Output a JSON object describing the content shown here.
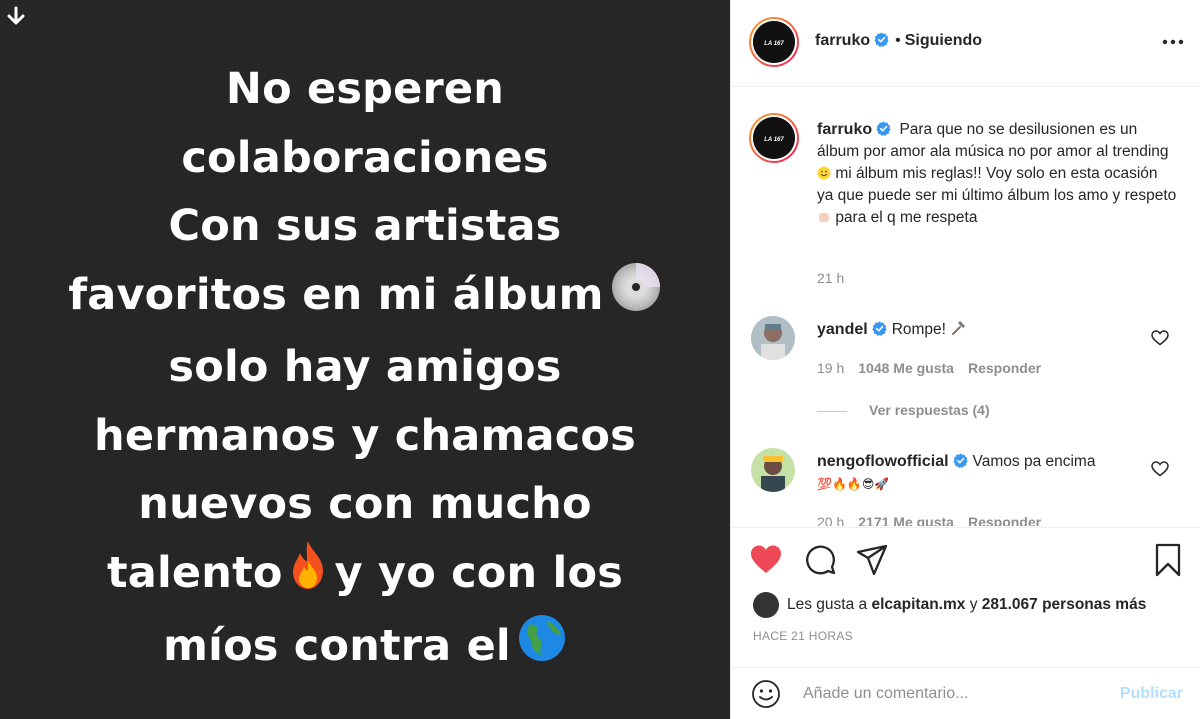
{
  "story": {
    "lines": [
      "No esperen",
      "colaboraciones",
      "Con sus artistas",
      "favoritos en mi álbum",
      "solo hay amigos",
      "hermanos y chamacos",
      "nuevos con mucho",
      "talento",
      "y yo con los",
      "míos contra el"
    ],
    "icons": [
      "cd-icon",
      "fire-icon",
      "globe-icon"
    ]
  },
  "header": {
    "username": "farruko",
    "separator": "•",
    "following_label": "Siguiendo"
  },
  "caption": {
    "username": "farruko",
    "text_part1": "Para que no se desilusionen es un álbum por amor ala música no por amor al trending",
    "text_part2": "mi álbum mis reglas!! Voy solo en esta ocasión ya que puede ser mi último álbum los amo y respeto",
    "text_part3": "para el q me respeta",
    "time": "21 h"
  },
  "comments": [
    {
      "username": "yandel",
      "text": "Rompe!",
      "time": "19 h",
      "likes": "1048 Me gusta",
      "reply_label": "Responder"
    },
    {
      "username": "nengoflowofficial",
      "text": "Vamos pa encima",
      "text_line2": "💯🔥🔥😎🚀",
      "time": "20 h",
      "likes": "2171 Me gusta",
      "reply_label": "Responder"
    }
  ],
  "view_replies": "Ver respuestas (4)",
  "likes_summary": {
    "prefix": "Les gusta a",
    "user": "elcapitan.mx",
    "connector": "y",
    "others": "281.067 personas más"
  },
  "posted_time": "HACE 21 HORAS",
  "add_comment": {
    "placeholder": "Añade un comentario...",
    "publish_label": "Publicar"
  },
  "colors": {
    "story_bg": "#262626",
    "heart_red": "#ed4956",
    "verified_blue": "#3897f0",
    "publish_disabled": "#b2dffc",
    "muted_text": "#8e8e8e"
  }
}
